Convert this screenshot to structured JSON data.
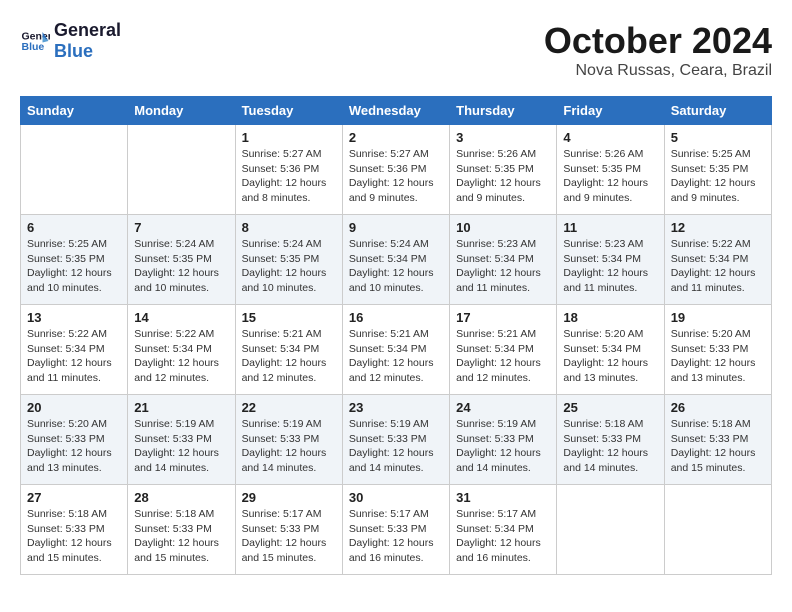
{
  "logo": {
    "line1": "General",
    "line2": "Blue"
  },
  "title": "October 2024",
  "location": "Nova Russas, Ceara, Brazil",
  "days_of_week": [
    "Sunday",
    "Monday",
    "Tuesday",
    "Wednesday",
    "Thursday",
    "Friday",
    "Saturday"
  ],
  "weeks": [
    [
      {
        "day": "",
        "content": ""
      },
      {
        "day": "",
        "content": ""
      },
      {
        "day": "1",
        "content": "Sunrise: 5:27 AM\nSunset: 5:36 PM\nDaylight: 12 hours\nand 8 minutes."
      },
      {
        "day": "2",
        "content": "Sunrise: 5:27 AM\nSunset: 5:36 PM\nDaylight: 12 hours\nand 9 minutes."
      },
      {
        "day": "3",
        "content": "Sunrise: 5:26 AM\nSunset: 5:35 PM\nDaylight: 12 hours\nand 9 minutes."
      },
      {
        "day": "4",
        "content": "Sunrise: 5:26 AM\nSunset: 5:35 PM\nDaylight: 12 hours\nand 9 minutes."
      },
      {
        "day": "5",
        "content": "Sunrise: 5:25 AM\nSunset: 5:35 PM\nDaylight: 12 hours\nand 9 minutes."
      }
    ],
    [
      {
        "day": "6",
        "content": "Sunrise: 5:25 AM\nSunset: 5:35 PM\nDaylight: 12 hours\nand 10 minutes."
      },
      {
        "day": "7",
        "content": "Sunrise: 5:24 AM\nSunset: 5:35 PM\nDaylight: 12 hours\nand 10 minutes."
      },
      {
        "day": "8",
        "content": "Sunrise: 5:24 AM\nSunset: 5:35 PM\nDaylight: 12 hours\nand 10 minutes."
      },
      {
        "day": "9",
        "content": "Sunrise: 5:24 AM\nSunset: 5:34 PM\nDaylight: 12 hours\nand 10 minutes."
      },
      {
        "day": "10",
        "content": "Sunrise: 5:23 AM\nSunset: 5:34 PM\nDaylight: 12 hours\nand 11 minutes."
      },
      {
        "day": "11",
        "content": "Sunrise: 5:23 AM\nSunset: 5:34 PM\nDaylight: 12 hours\nand 11 minutes."
      },
      {
        "day": "12",
        "content": "Sunrise: 5:22 AM\nSunset: 5:34 PM\nDaylight: 12 hours\nand 11 minutes."
      }
    ],
    [
      {
        "day": "13",
        "content": "Sunrise: 5:22 AM\nSunset: 5:34 PM\nDaylight: 12 hours\nand 11 minutes."
      },
      {
        "day": "14",
        "content": "Sunrise: 5:22 AM\nSunset: 5:34 PM\nDaylight: 12 hours\nand 12 minutes."
      },
      {
        "day": "15",
        "content": "Sunrise: 5:21 AM\nSunset: 5:34 PM\nDaylight: 12 hours\nand 12 minutes."
      },
      {
        "day": "16",
        "content": "Sunrise: 5:21 AM\nSunset: 5:34 PM\nDaylight: 12 hours\nand 12 minutes."
      },
      {
        "day": "17",
        "content": "Sunrise: 5:21 AM\nSunset: 5:34 PM\nDaylight: 12 hours\nand 12 minutes."
      },
      {
        "day": "18",
        "content": "Sunrise: 5:20 AM\nSunset: 5:34 PM\nDaylight: 12 hours\nand 13 minutes."
      },
      {
        "day": "19",
        "content": "Sunrise: 5:20 AM\nSunset: 5:33 PM\nDaylight: 12 hours\nand 13 minutes."
      }
    ],
    [
      {
        "day": "20",
        "content": "Sunrise: 5:20 AM\nSunset: 5:33 PM\nDaylight: 12 hours\nand 13 minutes."
      },
      {
        "day": "21",
        "content": "Sunrise: 5:19 AM\nSunset: 5:33 PM\nDaylight: 12 hours\nand 14 minutes."
      },
      {
        "day": "22",
        "content": "Sunrise: 5:19 AM\nSunset: 5:33 PM\nDaylight: 12 hours\nand 14 minutes."
      },
      {
        "day": "23",
        "content": "Sunrise: 5:19 AM\nSunset: 5:33 PM\nDaylight: 12 hours\nand 14 minutes."
      },
      {
        "day": "24",
        "content": "Sunrise: 5:19 AM\nSunset: 5:33 PM\nDaylight: 12 hours\nand 14 minutes."
      },
      {
        "day": "25",
        "content": "Sunrise: 5:18 AM\nSunset: 5:33 PM\nDaylight: 12 hours\nand 14 minutes."
      },
      {
        "day": "26",
        "content": "Sunrise: 5:18 AM\nSunset: 5:33 PM\nDaylight: 12 hours\nand 15 minutes."
      }
    ],
    [
      {
        "day": "27",
        "content": "Sunrise: 5:18 AM\nSunset: 5:33 PM\nDaylight: 12 hours\nand 15 minutes."
      },
      {
        "day": "28",
        "content": "Sunrise: 5:18 AM\nSunset: 5:33 PM\nDaylight: 12 hours\nand 15 minutes."
      },
      {
        "day": "29",
        "content": "Sunrise: 5:17 AM\nSunset: 5:33 PM\nDaylight: 12 hours\nand 15 minutes."
      },
      {
        "day": "30",
        "content": "Sunrise: 5:17 AM\nSunset: 5:33 PM\nDaylight: 12 hours\nand 16 minutes."
      },
      {
        "day": "31",
        "content": "Sunrise: 5:17 AM\nSunset: 5:34 PM\nDaylight: 12 hours\nand 16 minutes."
      },
      {
        "day": "",
        "content": ""
      },
      {
        "day": "",
        "content": ""
      }
    ]
  ]
}
